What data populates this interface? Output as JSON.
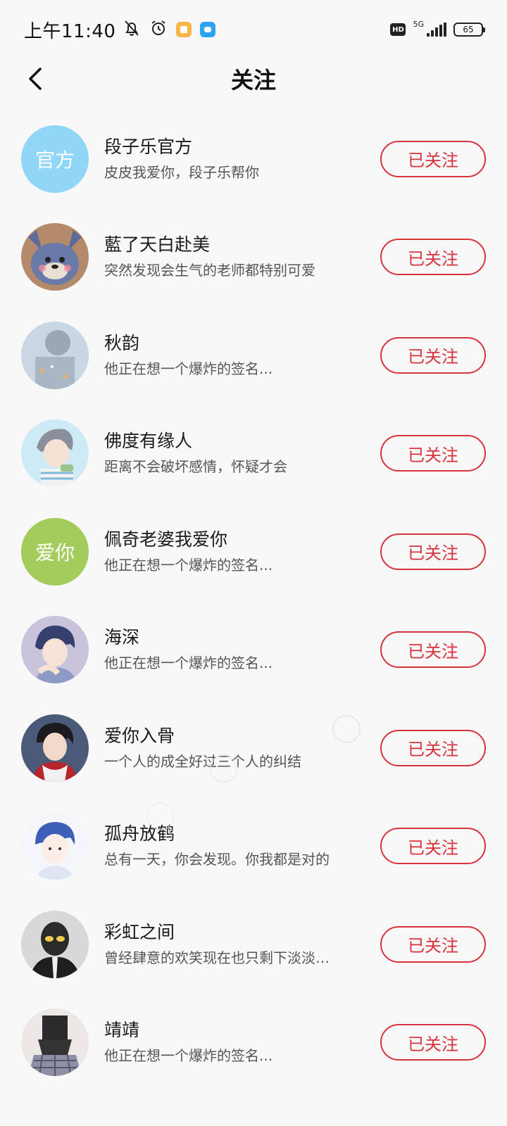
{
  "status_bar": {
    "time": "上午11:40",
    "left_icons": [
      "mute-bell-icon",
      "alarm-icon",
      "app-notification-icon",
      "message-app-icon"
    ],
    "hd_label": "HD",
    "network_label": "5G",
    "battery_level": "65"
  },
  "header": {
    "title": "关注",
    "back_icon": "chevron-left-icon"
  },
  "follow_list": [
    {
      "name": "段子乐官方",
      "signature": "皮皮我爱你，段子乐帮你",
      "avatar_text": "官方",
      "button": "已关注"
    },
    {
      "name": "藍了天白赴美",
      "signature": "突然发现会生气的老师都特别可爱",
      "avatar_text": "",
      "button": "已关注"
    },
    {
      "name": "秋韵",
      "signature": "他正在想一个爆炸的签名...",
      "avatar_text": "",
      "button": "已关注"
    },
    {
      "name": "佛度有缘人",
      "signature": "距离不会破坏感情，怀疑才会",
      "avatar_text": "",
      "button": "已关注"
    },
    {
      "name": "佩奇老婆我爱你",
      "signature": "他正在想一个爆炸的签名...",
      "avatar_text": "爱你",
      "button": "已关注"
    },
    {
      "name": "海深",
      "signature": "他正在想一个爆炸的签名...",
      "avatar_text": "",
      "button": "已关注"
    },
    {
      "name": "爱你入骨",
      "signature": "一个人的成全好过三个人的纠结",
      "avatar_text": "",
      "button": "已关注"
    },
    {
      "name": "孤舟放鹤",
      "signature": "总有一天，你会发现。你我都是对的",
      "avatar_text": "",
      "button": "已关注"
    },
    {
      "name": "彩虹之间",
      "signature": "曾经肆意的欢笑现在也只剩下淡淡…",
      "avatar_text": "",
      "button": "已关注"
    },
    {
      "name": "靖靖",
      "signature": "他正在想一个爆炸的签名...",
      "avatar_text": "",
      "button": "已关注"
    }
  ],
  "colors": {
    "accent": "#d8323c",
    "official_avatar": "#8fd6f7",
    "love_avatar": "#a3cc5d"
  }
}
